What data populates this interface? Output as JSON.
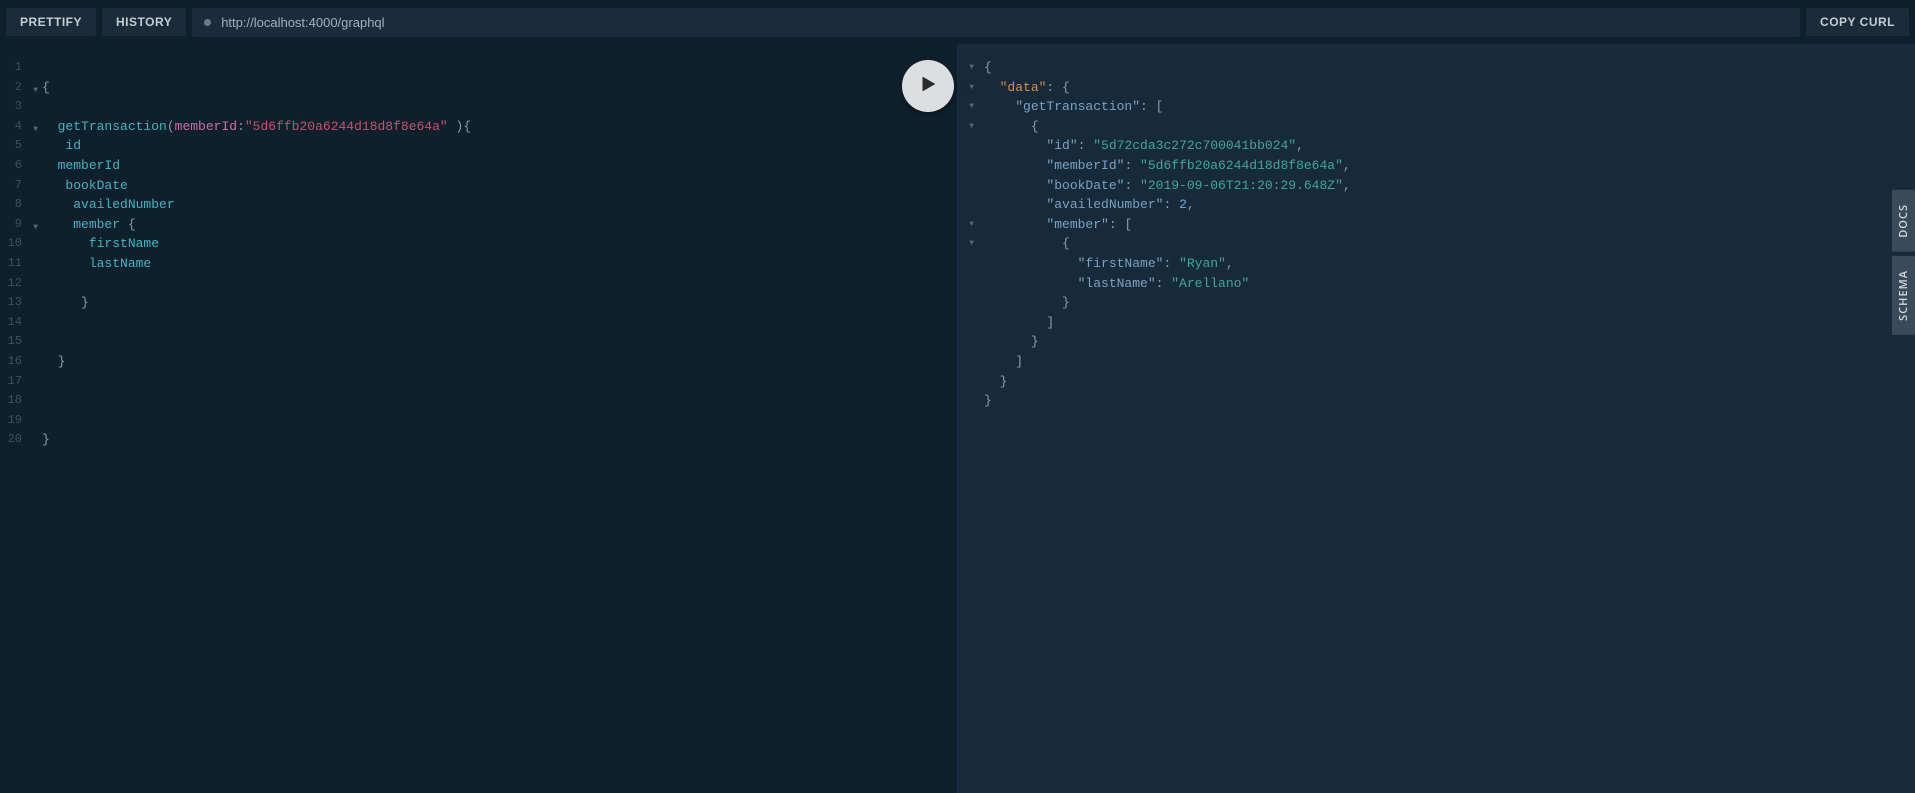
{
  "toolbar": {
    "prettify_label": "PRETTIFY",
    "history_label": "HISTORY",
    "copy_curl_label": "COPY CURL",
    "endpoint_url": "http://localhost:4000/graphql"
  },
  "side_tabs": {
    "docs_label": "DOCS",
    "schema_label": "SCHEMA"
  },
  "query": {
    "line_count": 20,
    "fold_lines": [
      2,
      4,
      9
    ],
    "lines": [
      {
        "n": 1,
        "t": []
      },
      {
        "n": 2,
        "t": [
          {
            "c": "q-brace",
            "v": "{"
          }
        ]
      },
      {
        "n": 3,
        "t": []
      },
      {
        "n": 4,
        "t": [
          {
            "c": "",
            "v": "  "
          },
          {
            "c": "q-field",
            "v": "getTransaction"
          },
          {
            "c": "q-punc",
            "v": "("
          },
          {
            "c": "q-arg",
            "v": "memberId"
          },
          {
            "c": "q-punc",
            "v": ":"
          },
          {
            "c": "q-string",
            "v": "\"5d6ffb20a6244d18d8f8e64a\""
          },
          {
            "c": "",
            "v": " "
          },
          {
            "c": "q-punc",
            "v": ")"
          },
          {
            "c": "q-brace",
            "v": "{"
          }
        ]
      },
      {
        "n": 5,
        "t": [
          {
            "c": "",
            "v": "   "
          },
          {
            "c": "q-field",
            "v": "id"
          }
        ]
      },
      {
        "n": 6,
        "t": [
          {
            "c": "",
            "v": "  "
          },
          {
            "c": "q-field",
            "v": "memberId"
          }
        ]
      },
      {
        "n": 7,
        "t": [
          {
            "c": "",
            "v": "   "
          },
          {
            "c": "q-field",
            "v": "bookDate"
          }
        ]
      },
      {
        "n": 8,
        "t": [
          {
            "c": "",
            "v": "    "
          },
          {
            "c": "q-field",
            "v": "availedNumber"
          }
        ]
      },
      {
        "n": 9,
        "t": [
          {
            "c": "",
            "v": "    "
          },
          {
            "c": "q-field",
            "v": "member"
          },
          {
            "c": "",
            "v": " "
          },
          {
            "c": "q-brace",
            "v": "{"
          }
        ]
      },
      {
        "n": 10,
        "t": [
          {
            "c": "",
            "v": "      "
          },
          {
            "c": "q-field",
            "v": "firstName"
          }
        ]
      },
      {
        "n": 11,
        "t": [
          {
            "c": "",
            "v": "      "
          },
          {
            "c": "q-field",
            "v": "lastName"
          }
        ]
      },
      {
        "n": 12,
        "t": []
      },
      {
        "n": 13,
        "t": [
          {
            "c": "",
            "v": "     "
          },
          {
            "c": "q-brace",
            "v": "}"
          }
        ]
      },
      {
        "n": 14,
        "t": []
      },
      {
        "n": 15,
        "t": []
      },
      {
        "n": 16,
        "t": [
          {
            "c": "",
            "v": "  "
          },
          {
            "c": "q-brace",
            "v": "}"
          }
        ]
      },
      {
        "n": 17,
        "t": []
      },
      {
        "n": 18,
        "t": []
      },
      {
        "n": 19,
        "t": []
      },
      {
        "n": 20,
        "t": [
          {
            "c": "q-brace",
            "v": "}"
          }
        ]
      }
    ]
  },
  "result": {
    "fold_lines": [
      1,
      2,
      3,
      4,
      9,
      10
    ],
    "lines": [
      [
        {
          "c": "r-punc",
          "v": "{"
        }
      ],
      [
        {
          "c": "",
          "v": "  "
        },
        {
          "c": "r-key-top",
          "v": "\"data\""
        },
        {
          "c": "r-punc",
          "v": ": {"
        }
      ],
      [
        {
          "c": "",
          "v": "    "
        },
        {
          "c": "r-key",
          "v": "\"getTransaction\""
        },
        {
          "c": "r-punc",
          "v": ": ["
        }
      ],
      [
        {
          "c": "",
          "v": "      "
        },
        {
          "c": "r-punc",
          "v": "{"
        }
      ],
      [
        {
          "c": "",
          "v": "        "
        },
        {
          "c": "r-key",
          "v": "\"id\""
        },
        {
          "c": "r-punc",
          "v": ": "
        },
        {
          "c": "r-string",
          "v": "\"5d72cda3c272c700041bb024\""
        },
        {
          "c": "r-punc",
          "v": ","
        }
      ],
      [
        {
          "c": "",
          "v": "        "
        },
        {
          "c": "r-key",
          "v": "\"memberId\""
        },
        {
          "c": "r-punc",
          "v": ": "
        },
        {
          "c": "r-string",
          "v": "\"5d6ffb20a6244d18d8f8e64a\""
        },
        {
          "c": "r-punc",
          "v": ","
        }
      ],
      [
        {
          "c": "",
          "v": "        "
        },
        {
          "c": "r-key",
          "v": "\"bookDate\""
        },
        {
          "c": "r-punc",
          "v": ": "
        },
        {
          "c": "r-string",
          "v": "\"2019-09-06T21:20:29.648Z\""
        },
        {
          "c": "r-punc",
          "v": ","
        }
      ],
      [
        {
          "c": "",
          "v": "        "
        },
        {
          "c": "r-key",
          "v": "\"availedNumber\""
        },
        {
          "c": "r-punc",
          "v": ": "
        },
        {
          "c": "r-num",
          "v": "2"
        },
        {
          "c": "r-punc",
          "v": ","
        }
      ],
      [
        {
          "c": "",
          "v": "        "
        },
        {
          "c": "r-key",
          "v": "\"member\""
        },
        {
          "c": "r-punc",
          "v": ": ["
        }
      ],
      [
        {
          "c": "",
          "v": "          "
        },
        {
          "c": "r-punc",
          "v": "{"
        }
      ],
      [
        {
          "c": "",
          "v": "            "
        },
        {
          "c": "r-key",
          "v": "\"firstName\""
        },
        {
          "c": "r-punc",
          "v": ": "
        },
        {
          "c": "r-string",
          "v": "\"Ryan\""
        },
        {
          "c": "r-punc",
          "v": ","
        }
      ],
      [
        {
          "c": "",
          "v": "            "
        },
        {
          "c": "r-key",
          "v": "\"lastName\""
        },
        {
          "c": "r-punc",
          "v": ": "
        },
        {
          "c": "r-string",
          "v": "\"Arellano\""
        }
      ],
      [
        {
          "c": "",
          "v": "          "
        },
        {
          "c": "r-punc",
          "v": "}"
        }
      ],
      [
        {
          "c": "",
          "v": "        "
        },
        {
          "c": "r-punc",
          "v": "]"
        }
      ],
      [
        {
          "c": "",
          "v": "      "
        },
        {
          "c": "r-punc",
          "v": "}"
        }
      ],
      [
        {
          "c": "",
          "v": "    "
        },
        {
          "c": "r-punc",
          "v": "]"
        }
      ],
      [
        {
          "c": "",
          "v": "  "
        },
        {
          "c": "r-punc",
          "v": "}"
        }
      ],
      [
        {
          "c": "r-punc",
          "v": "}"
        }
      ]
    ]
  }
}
